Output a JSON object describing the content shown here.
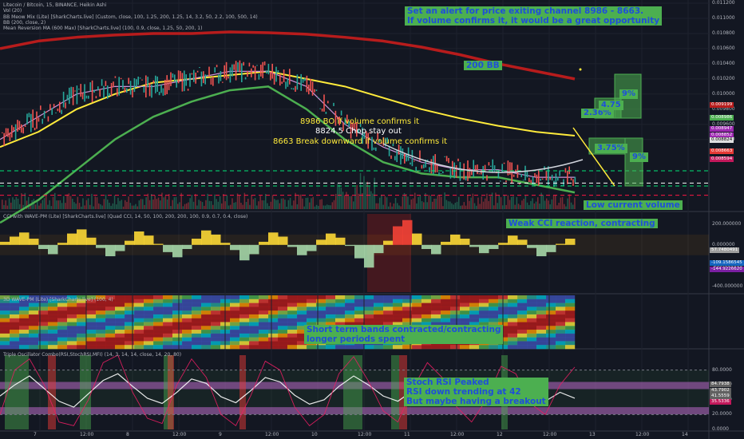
{
  "header": {
    "lines": [
      "Litecoin / Bitcoin, 15, BINANCE, Heikin Ashi",
      "Vol (20)",
      "BB Meow Mix (Lite) [SharkCharts.live] (Custom, close, 100, 1.25, 200, 1.25, 14, 3.2, 50, 2.2, 100, 500, 14)",
      "BB (200, close, 2)",
      "Mean Reversion MA (600 Max) [SharkCharts.live] (100, 0.9, close, 1.25, 50, 200, 1)"
    ]
  },
  "panes": {
    "cci_label": "CCI with WAVE-PM (Lite) [SharkCharts.live] (Quad CCI, 14, 50, 100, 200, 200, 100, 0.9, 0.7, 0.4, close)",
    "wave_label": "3D WAVE-PM (Lite) [SharkCharts.live] (100, 4)",
    "osc_label": "Triple Oscillator Combo(RSI,StochRSI,MFI) (14, 3, 14, 14, close, 14, 20, 80)"
  },
  "annotations": {
    "alert": "Set an alert for price exiting channel 8986 - 8663.\nIf volume confirms it, it would be a great opportunity",
    "bb200": "200 BB",
    "bo": "8986 BO if volume confirms it",
    "chop": "8824.5 Chop stay out",
    "break": "8663 Break downward if volume confirms it",
    "low_volume": "Low current volume",
    "cci": "Weak CCI reaction, contracting",
    "bands": "Short term bands contracted/contracting\nlonger periods spent",
    "stoch": "Stoch RSI Peaked\nRSI down trending at 42\nBut maybe having a breakout",
    "pct_up_small": "2.36%",
    "pct_up_mid": "4.75",
    "pct_up_big": "9%",
    "pct_down_small": "3.75%",
    "pct_down_big": "9%"
  },
  "price_tags": [
    "0.009199",
    "0.008986",
    "0.008947",
    "0.008852",
    "0.008824",
    "0.008663",
    "0.008594"
  ],
  "cci_tags": [
    "57.7480491",
    "-109.1586545",
    "-144.9226620"
  ],
  "osc_tags": [
    "84.7938",
    "43.7902",
    "41.5559",
    "35.5336"
  ],
  "colors": {
    "background": "#131722",
    "bb200": "#b71c1c",
    "yellow_ma": "#ffeb3b",
    "green_ma": "#4caf50",
    "dashed_green": "#00e676",
    "dashed_red": "#ff1744",
    "box": "#4caf50"
  },
  "chart_data": [
    {
      "type": "line",
      "pane": "price",
      "y_axis": {
        "ticks": [
          0.0112,
          0.011,
          0.0108,
          0.0106,
          0.0104,
          0.0102,
          0.01,
          0.0098,
          0.0096,
          0.0094
        ],
        "labels": [
          "0.011200",
          "0.011000",
          "0.010800",
          "0.010600",
          "0.010400",
          "0.010200",
          "0.010000",
          "0.009800",
          "0.009600",
          "0.009400"
        ]
      },
      "x_axis": {
        "labels": [
          "7",
          "12:00",
          "8",
          "12:00",
          "9",
          "12:00",
          "10",
          "12:00",
          "11",
          "12:00",
          "12",
          "12:00",
          "13",
          "12:00",
          "14"
        ]
      },
      "levels": [
        {
          "value": 0.008986,
          "style": "dashed-green"
        },
        {
          "value": 0.008824,
          "style": "dashed-white"
        },
        {
          "value": 0.008663,
          "style": "dashed-red"
        }
      ],
      "series": [
        {
          "name": "200 BB",
          "values": [
            0.0106,
            0.0107,
            0.01075,
            0.01078,
            0.0108,
            0.0108,
            0.01082,
            0.01081,
            0.01079,
            0.01075,
            0.0107,
            0.01062,
            0.01052,
            0.0104,
            0.0103,
            0.0102
          ]
        },
        {
          "values": [
            0.0093,
            0.0095,
            0.0098,
            0.01,
            0.01015,
            0.0102,
            0.01025,
            0.0103,
            0.0102,
            0.0101,
            0.00995,
            0.0098,
            0.00968,
            0.00958,
            0.0095,
            0.00945
          ]
        },
        {
          "values": [
            0.0083,
            0.0086,
            0.009,
            0.0094,
            0.0097,
            0.0099,
            0.01005,
            0.0101,
            0.0098,
            0.0094,
            0.0091,
            0.00895,
            0.0089,
            0.0089,
            0.0088,
            0.0087
          ]
        },
        {
          "values": [
            0.0094,
            0.0097,
            0.01,
            0.0101,
            0.0101,
            0.0102,
            0.0103,
            0.0103,
            0.0101,
            0.0096,
            0.0093,
            0.0091,
            0.009,
            0.009,
            0.0089,
            0.0089
          ]
        }
      ]
    },
    {
      "type": "bar",
      "pane": "cci",
      "y_axis": {
        "ticks": [
          200,
          0,
          -200,
          -400
        ],
        "labels": [
          "200.000000",
          "0.000000",
          "-200.000000",
          "-400.000000"
        ]
      },
      "values": [
        30,
        80,
        120,
        60,
        -40,
        -90,
        20,
        110,
        150,
        70,
        -30,
        -110,
        -60,
        40,
        130,
        90,
        10,
        -70,
        -120,
        -40,
        60,
        140,
        100,
        20,
        -50,
        -150,
        -90,
        30,
        120,
        80,
        -20,
        -100,
        -60,
        50,
        110,
        70,
        -10,
        -130,
        -220,
        -80,
        40,
        180,
        240,
        110,
        -40,
        -90,
        30,
        100,
        60,
        -20,
        -80,
        -40,
        20,
        90,
        50,
        -30,
        -110,
        -70,
        10,
        60
      ]
    },
    {
      "type": "line",
      "pane": "oscillator",
      "y_axis": {
        "ticks": [
          80,
          60,
          40,
          20,
          0
        ],
        "labels": [
          "80.0000",
          "60.0000",
          "40.0000",
          "20.0000",
          "0.0000"
        ]
      },
      "series": [
        {
          "values": [
            45,
            60,
            72,
            55,
            38,
            30,
            48,
            66,
            75,
            58,
            42,
            35,
            50,
            68,
            62,
            44,
            36,
            52,
            70,
            64,
            46,
            34,
            40,
            58,
            72,
            60,
            45,
            38,
            52,
            66,
            58,
            42,
            36,
            48,
            62,
            56,
            44,
            38,
            50,
            42
          ]
        },
        {
          "values": [
            20,
            80,
            95,
            60,
            10,
            5,
            40,
            90,
            100,
            50,
            15,
            8,
            60,
            95,
            70,
            20,
            5,
            45,
            92,
            80,
            30,
            5,
            20,
            75,
            98,
            65,
            25,
            10,
            55,
            90,
            70,
            30,
            10,
            40,
            85,
            75,
            35,
            20,
            60,
            84
          ]
        }
      ]
    }
  ]
}
